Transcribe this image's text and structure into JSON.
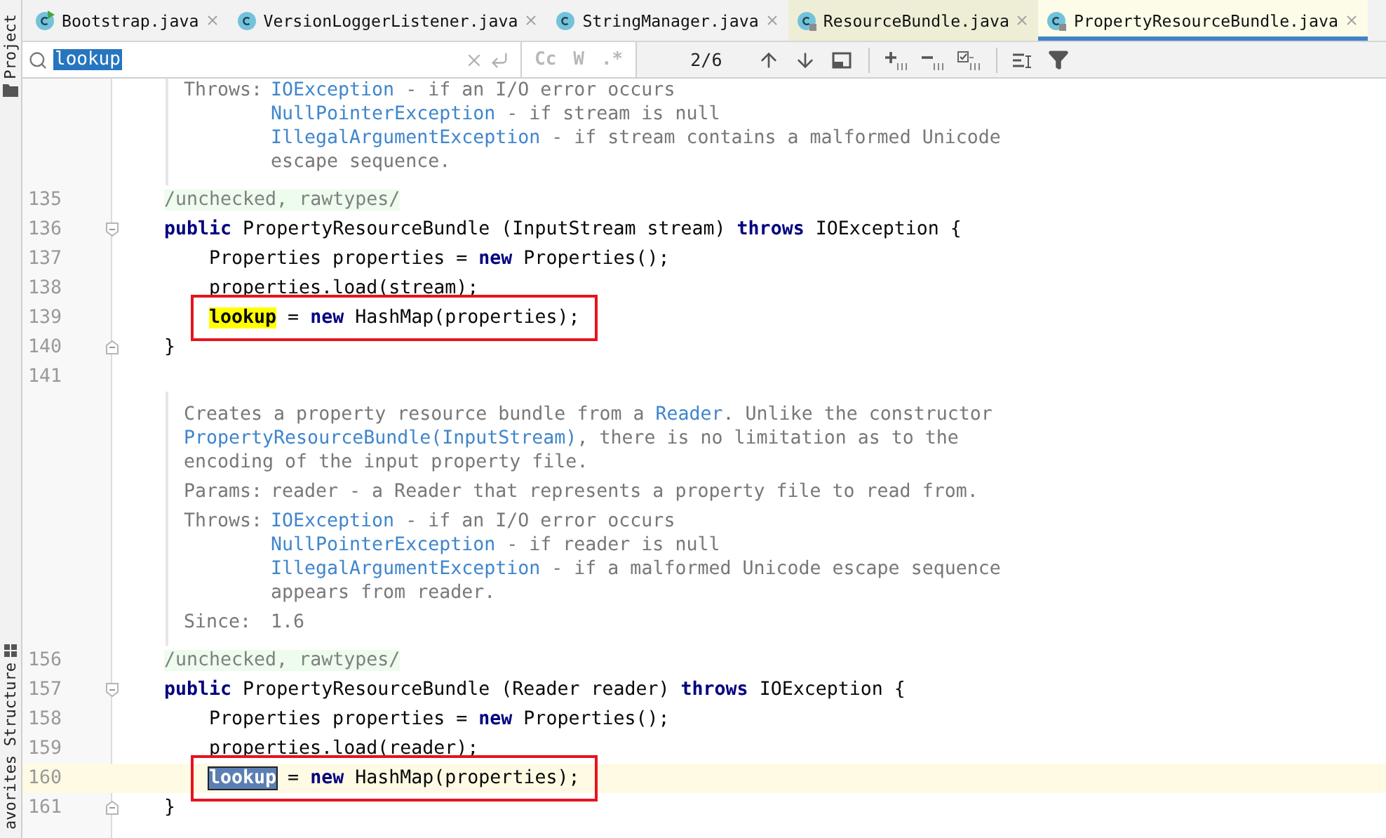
{
  "side_panels": [
    {
      "label": "Project",
      "kind": "folder"
    },
    {
      "label": "Structure",
      "kind": "structure"
    },
    {
      "label": "avorites",
      "kind": "plain"
    }
  ],
  "tabs": [
    {
      "label": "Bootstrap.java",
      "kind": "runnable",
      "library": false,
      "selected": false
    },
    {
      "label": "VersionLoggerListener.java",
      "kind": "class",
      "library": false,
      "selected": false
    },
    {
      "label": "StringManager.java",
      "kind": "class",
      "library": false,
      "selected": false
    },
    {
      "label": "ResourceBundle.java",
      "kind": "locked",
      "library": true,
      "selected": false
    },
    {
      "label": "PropertyResourceBundle.java",
      "kind": "locked",
      "library": true,
      "selected": true
    }
  ],
  "search": {
    "value": "lookup",
    "value_selected": true,
    "match_count": "2/6",
    "toggles": [
      {
        "label": "Cc",
        "selected": false
      },
      {
        "label": "W",
        "selected": false
      },
      {
        "label": ".*",
        "selected": false
      }
    ]
  },
  "rows": [
    {
      "kind": "doc",
      "sections": [
        {
          "label": "Throws:",
          "lines": [
            [
              {
                "t": "IOException",
                "link": true
              },
              {
                "t": " - if an I/O error occurs",
                "link": false
              }
            ],
            [
              {
                "t": "NullPointerException",
                "link": true
              },
              {
                "t": " - if stream is null",
                "link": false
              }
            ],
            [
              {
                "t": "IllegalArgumentException",
                "link": true
              },
              {
                "t": " - if stream contains a malformed Unicode",
                "link": false
              }
            ],
            [
              {
                "t": "escape sequence.",
                "link": false
              }
            ]
          ]
        }
      ]
    },
    {
      "kind": "member",
      "number": "135",
      "current": false,
      "boxed": false,
      "fold_start": false,
      "fold_end": false,
      "tokens": [
        {
          "t": "/unchecked, rawtypes/",
          "kind": "annotation"
        }
      ]
    },
    {
      "kind": "member",
      "number": "136",
      "current": false,
      "boxed": false,
      "fold_start": true,
      "fold_end": false,
      "tokens": [
        {
          "t": "public",
          "kind": "keyword"
        },
        {
          "t": " PropertyResourceBundle (InputStream stream) ",
          "kind": "plain"
        },
        {
          "t": "throws",
          "kind": "keyword"
        },
        {
          "t": " IOException {",
          "kind": "plain"
        }
      ]
    },
    {
      "kind": "body",
      "number": "137",
      "current": false,
      "boxed": false,
      "fold_start": false,
      "fold_end": false,
      "tokens": [
        {
          "t": "Properties properties = ",
          "kind": "plain"
        },
        {
          "t": "new",
          "kind": "keyword"
        },
        {
          "t": " Properties();",
          "kind": "plain"
        }
      ]
    },
    {
      "kind": "body",
      "number": "138",
      "current": false,
      "boxed": false,
      "fold_start": false,
      "fold_end": false,
      "tokens": [
        {
          "t": "properties.load(stream);",
          "kind": "plain"
        }
      ]
    },
    {
      "kind": "body",
      "number": "139",
      "current": false,
      "boxed": true,
      "fold_start": false,
      "fold_end": false,
      "tokens": [
        {
          "t": "lookup",
          "kind": "match"
        },
        {
          "t": " = ",
          "kind": "plain"
        },
        {
          "t": "new",
          "kind": "keyword"
        },
        {
          "t": " HashMap(properties);",
          "kind": "plain"
        }
      ]
    },
    {
      "kind": "member",
      "number": "140",
      "current": false,
      "boxed": false,
      "fold_start": false,
      "fold_end": true,
      "tokens": [
        {
          "t": "}",
          "kind": "plain"
        }
      ]
    },
    {
      "kind": "member",
      "number": "141",
      "current": false,
      "boxed": false,
      "fold_start": false,
      "fold_end": false
    },
    {
      "kind": "doc",
      "sections": [
        {
          "lines": [
            [
              {
                "t": "Creates a property resource bundle from a ",
                "link": false
              },
              {
                "t": "Reader",
                "link": true
              },
              {
                "t": ". Unlike the constructor",
                "link": false
              }
            ],
            [
              {
                "t": "PropertyResourceBundle(InputStream)",
                "link": true
              },
              {
                "t": ", there is no limitation as to the",
                "link": false
              }
            ],
            [
              {
                "t": "encoding of the input property file.",
                "link": false
              }
            ]
          ]
        },
        {
          "label": "Params:",
          "lines": [
            [
              {
                "t": "reader - a Reader that represents a property file to read from.",
                "link": false
              }
            ]
          ]
        },
        {
          "label": "Throws:",
          "lines": [
            [
              {
                "t": "IOException",
                "link": true
              },
              {
                "t": " - if an I/O error occurs",
                "link": false
              }
            ],
            [
              {
                "t": "NullPointerException",
                "link": true
              },
              {
                "t": " - if reader is null",
                "link": false
              }
            ],
            [
              {
                "t": "IllegalArgumentException",
                "link": true
              },
              {
                "t": " - if a malformed Unicode escape sequence",
                "link": false
              }
            ],
            [
              {
                "t": "appears from reader.",
                "link": false
              }
            ]
          ]
        },
        {
          "label": "Since:",
          "lines": [
            [
              {
                "t": "1.6",
                "link": false
              }
            ]
          ]
        }
      ]
    },
    {
      "kind": "member",
      "number": "156",
      "current": false,
      "boxed": false,
      "fold_start": false,
      "fold_end": false,
      "tokens": [
        {
          "t": "/unchecked, rawtypes/",
          "kind": "annotation"
        }
      ]
    },
    {
      "kind": "member",
      "number": "157",
      "current": false,
      "boxed": false,
      "fold_start": true,
      "fold_end": false,
      "tokens": [
        {
          "t": "public",
          "kind": "keyword"
        },
        {
          "t": " PropertyResourceBundle (Reader reader) ",
          "kind": "plain"
        },
        {
          "t": "throws",
          "kind": "keyword"
        },
        {
          "t": " IOException {",
          "kind": "plain"
        }
      ]
    },
    {
      "kind": "body",
      "number": "158",
      "current": false,
      "boxed": false,
      "fold_start": false,
      "fold_end": false,
      "tokens": [
        {
          "t": "Properties properties = ",
          "kind": "plain"
        },
        {
          "t": "new",
          "kind": "keyword"
        },
        {
          "t": " Properties();",
          "kind": "plain"
        }
      ]
    },
    {
      "kind": "body",
      "number": "159",
      "current": false,
      "boxed": false,
      "fold_start": false,
      "fold_end": false,
      "tokens": [
        {
          "t": "properties.load(reader);",
          "kind": "plain"
        }
      ]
    },
    {
      "kind": "body",
      "number": "160",
      "current": true,
      "boxed": true,
      "fold_start": false,
      "fold_end": false,
      "tokens": [
        {
          "t": "lookup",
          "kind": "current-match"
        },
        {
          "t": " = ",
          "kind": "plain"
        },
        {
          "t": "new",
          "kind": "keyword"
        },
        {
          "t": " HashMap(properties);",
          "kind": "plain"
        }
      ]
    },
    {
      "kind": "member",
      "number": "161",
      "current": false,
      "boxed": false,
      "fold_start": false,
      "fold_end": true,
      "tokens": [
        {
          "t": "}",
          "kind": "plain"
        }
      ]
    }
  ]
}
